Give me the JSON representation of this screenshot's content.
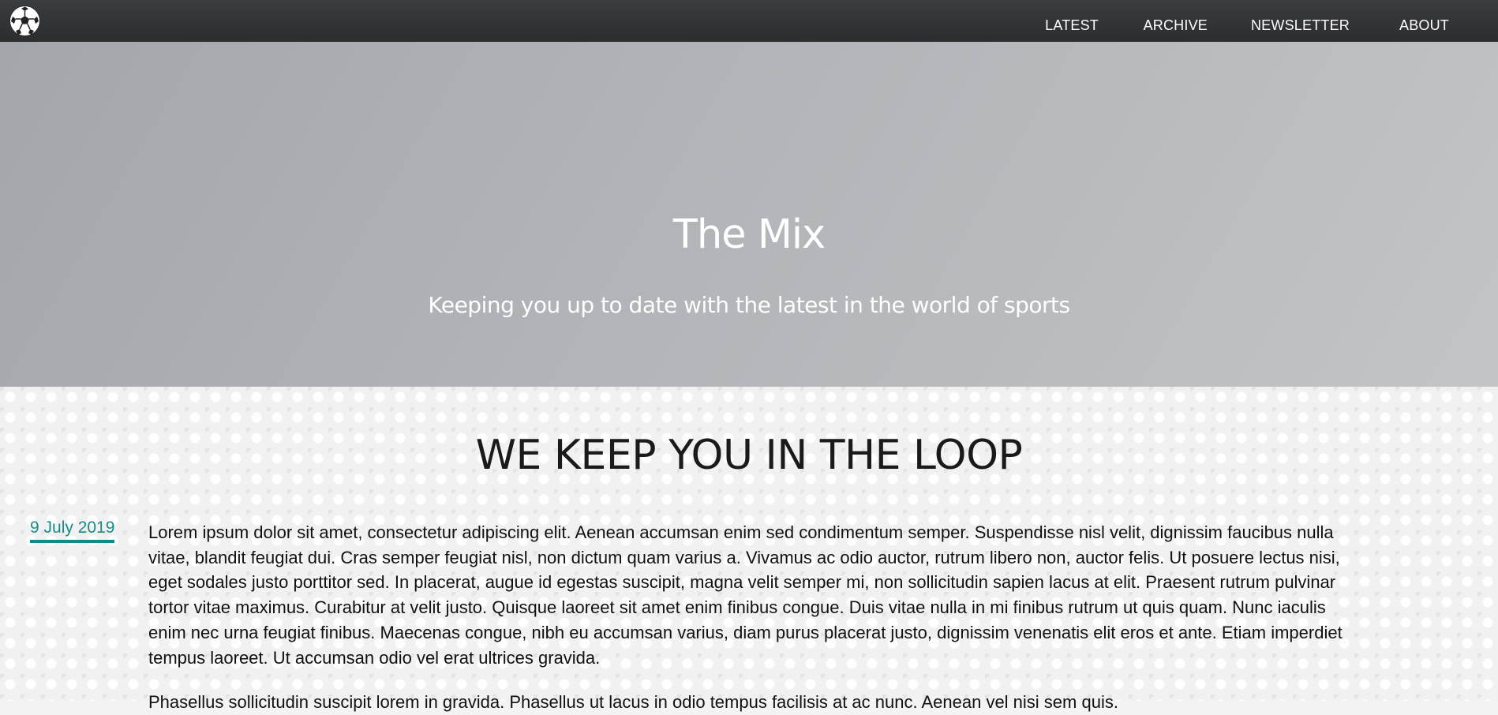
{
  "header": {
    "logo_icon": "soccer-ball-icon",
    "nav": [
      {
        "label": "LATEST"
      },
      {
        "label": "ARCHIVE"
      },
      {
        "label": "NEWSLETTER"
      },
      {
        "label": "ABOUT"
      }
    ]
  },
  "hero": {
    "title": "The Mix",
    "subtitle": "Keeping you up to date with the latest in the world of sports"
  },
  "section": {
    "title": "WE KEEP YOU IN THE LOOP"
  },
  "post": {
    "date": "9 July 2019",
    "paragraphs": [
      "Lorem ipsum dolor sit amet, consectetur adipiscing elit. Aenean accumsan enim sed condimentum semper. Suspendisse nisl velit, dignissim faucibus nulla vitae, blandit feugiat dui. Cras semper feugiat nisl, non dictum quam varius a. Vivamus ac odio auctor, rutrum libero non, auctor felis. Ut posuere lectus nisi, eget sodales justo porttitor sed. In placerat, augue id egestas suscipit, magna velit semper mi, non sollicitudin sapien lacus at elit. Praesent rutrum pulvinar tortor vitae maximus. Curabitur at velit justo. Quisque laoreet sit amet enim finibus congue. Duis vitae nulla in mi finibus rutrum ut quis quam. Nunc iaculis enim nec urna feugiat finibus. Maecenas congue, nibh eu accumsan varius, diam purus placerat justo, dignissim venenatis elit eros et ante. Etiam imperdiet tempus laoreet. Ut accumsan odio vel erat ultrices gravida.",
      "Phasellus sollicitudin suscipit lorem in gravida. Phasellus ut lacus in odio tempus facilisis at ac nunc. Aenean vel nisi sem quis."
    ]
  },
  "colors": {
    "topbar": "#333436",
    "accent": "#138a8a"
  }
}
